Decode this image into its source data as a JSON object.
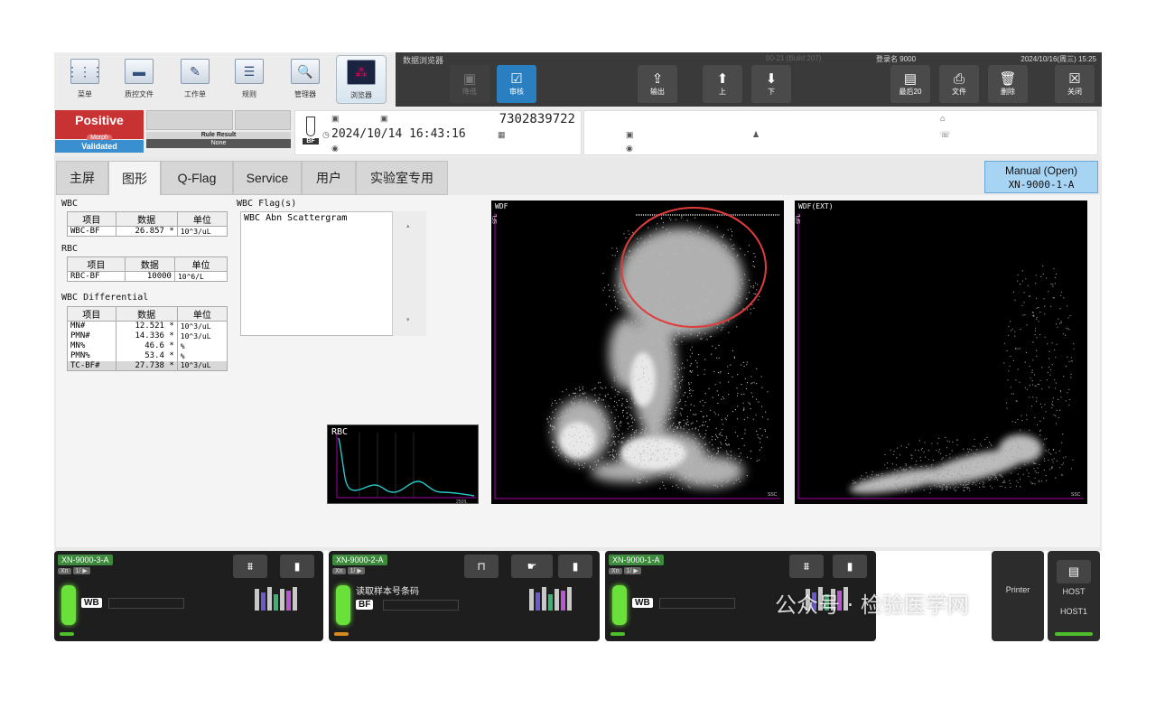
{
  "toolbar": {
    "items": [
      {
        "label": "菜单",
        "icon": "menu-grid-icon"
      },
      {
        "label": "质控文件",
        "icon": "qc-folder-icon"
      },
      {
        "label": "工作单",
        "icon": "worklist-icon"
      },
      {
        "label": "规则",
        "icon": "rules-icon"
      },
      {
        "label": "管理器",
        "icon": "manager-icon"
      },
      {
        "label": "浏览器",
        "icon": "browser-icon"
      }
    ]
  },
  "darkbar": {
    "title": "数据浏览器",
    "version": "00-21 (Build 207)",
    "user": "登录名 9000",
    "datetime": "2024/10/16(周三) 15:25",
    "buttons": {
      "disabled_label": "降低",
      "validate_label": "审核",
      "output_label": "输出",
      "up_label": "上",
      "down_label": "下",
      "last20_label": "最后20",
      "file_label": "文件",
      "delete_label": "删除",
      "close_label": "关闭"
    }
  },
  "status": {
    "positive": "Positive",
    "positive_tag": "Morph",
    "validated": "Validated",
    "rule_result_label": "Rule Result",
    "rule_result_value": "None"
  },
  "sample": {
    "tube_mode": "BF",
    "sample_no": "7302839722",
    "datetime": "2024/10/14 16:43:16"
  },
  "tabs": [
    "主屏",
    "图形",
    "Q-Flag",
    "Service",
    "用户",
    "实验室专用"
  ],
  "active_tab": "图形",
  "manual": {
    "line1": "Manual (Open)",
    "line2": "XN-9000-1-A"
  },
  "wbc": {
    "title": "WBC",
    "headers": [
      "项目",
      "数据",
      "单位"
    ],
    "rows": [
      {
        "item": "WBC-BF",
        "value": "26.857",
        "flag": "*",
        "unit": "10^3/uL"
      }
    ]
  },
  "rbc": {
    "title": "RBC",
    "headers": [
      "项目",
      "数据",
      "单位"
    ],
    "rows": [
      {
        "item": "RBC-BF",
        "value": "10000",
        "flag": "",
        "unit": "10^6/L"
      }
    ]
  },
  "diff": {
    "title": "WBC Differential",
    "headers": [
      "项目",
      "数据",
      "单位"
    ],
    "rows": [
      {
        "item": "MN#",
        "value": "12.521",
        "flag": "*",
        "unit": "10^3/uL"
      },
      {
        "item": "PMN#",
        "value": "14.336",
        "flag": "*",
        "unit": "10^3/uL"
      },
      {
        "item": "MN%",
        "value": "46.6",
        "flag": "*",
        "unit": "%"
      },
      {
        "item": "PMN%",
        "value": "53.4",
        "flag": "*",
        "unit": "%"
      },
      {
        "item": "TC-BF#",
        "value": "27.738",
        "flag": "*",
        "unit": "10^3/uL"
      }
    ]
  },
  "flags": {
    "title": "WBC Flag(s)",
    "items": [
      "WBC Abn Scattergram"
    ]
  },
  "plots": {
    "rbc": {
      "title": "RBC",
      "xmax": "250fL"
    },
    "wdf": {
      "title": "WDF",
      "y_axis": "SFL",
      "x_axis": "SSC"
    },
    "wdf_ext": {
      "title": "WDF(EXT)",
      "y_axis": "SFL",
      "x_axis": "SSC"
    }
  },
  "analyzers": [
    {
      "name": "XN-9000-3-A",
      "mode": "WB",
      "message": ""
    },
    {
      "name": "XN-9000-2-A",
      "mode": "BF",
      "message": "读取样本号条码"
    },
    {
      "name": "XN-9000-1-A",
      "mode": "WB",
      "message": ""
    }
  ],
  "side": {
    "printer": "Printer",
    "host": "HOST",
    "host1": "HOST1"
  },
  "watermark": "公众号 · 检验医学网",
  "colors": {
    "positive": "#c83232",
    "validated": "#3a8fd0",
    "manual": "#a8d4f4",
    "led": "#6ae03a",
    "circle": "#e03c3c",
    "rbc_curve": "#28c8c8"
  }
}
